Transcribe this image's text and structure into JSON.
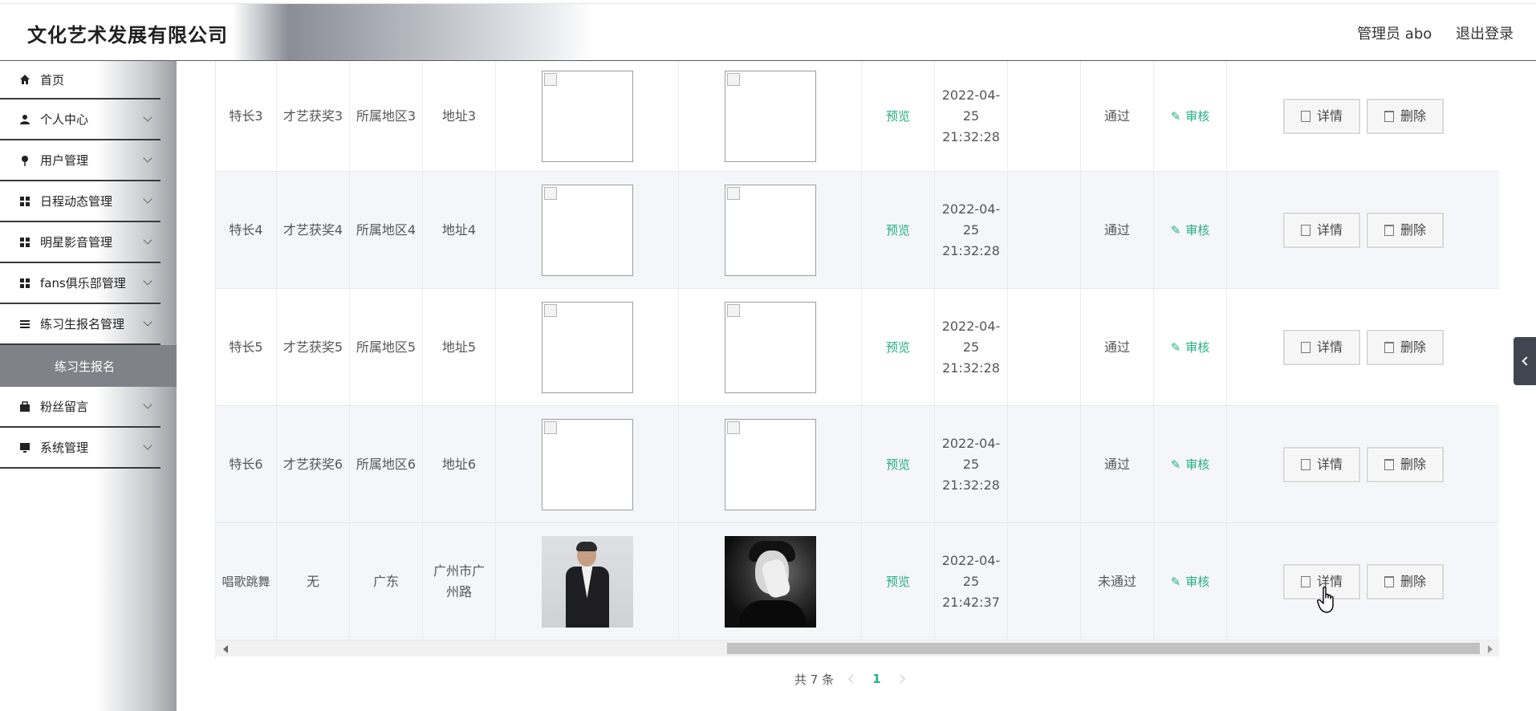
{
  "header": {
    "brand": "文化艺术发展有限公司",
    "user_label": "管理员 abo",
    "logout_label": "退出登录"
  },
  "sidebar": {
    "items": [
      {
        "label": "首页",
        "icon": "home-icon"
      },
      {
        "label": "个人中心",
        "icon": "user-icon"
      },
      {
        "label": "用户管理",
        "icon": "pin-icon"
      },
      {
        "label": "日程动态管理",
        "icon": "grid-icon"
      },
      {
        "label": "明星影音管理",
        "icon": "grid-icon"
      },
      {
        "label": "fans俱乐部管理",
        "icon": "grid-icon"
      },
      {
        "label": "练习生报名管理",
        "icon": "list-icon"
      },
      {
        "label": "粉丝留言",
        "icon": "briefcase-icon"
      },
      {
        "label": "系统管理",
        "icon": "monitor-icon"
      }
    ],
    "active_sub": "练习生报名"
  },
  "table": {
    "rows": [
      {
        "talent": "特长3",
        "award": "才艺获奖3",
        "region": "所属地区3",
        "address": "地址3",
        "preview": "预览",
        "time": "2022-04-25 21:32:28",
        "status": "通过",
        "audit": "审核",
        "detail": "详情",
        "delete": "删除"
      },
      {
        "talent": "特长4",
        "award": "才艺获奖4",
        "region": "所属地区4",
        "address": "地址4",
        "preview": "预览",
        "time": "2022-04-25 21:32:28",
        "status": "通过",
        "audit": "审核",
        "detail": "详情",
        "delete": "删除"
      },
      {
        "talent": "特长5",
        "award": "才艺获奖5",
        "region": "所属地区5",
        "address": "地址5",
        "preview": "预览",
        "time": "2022-04-25 21:32:28",
        "status": "通过",
        "audit": "审核",
        "detail": "详情",
        "delete": "删除"
      },
      {
        "talent": "特长6",
        "award": "才艺获奖6",
        "region": "所属地区6",
        "address": "地址6",
        "preview": "预览",
        "time": "2022-04-25 21:32:28",
        "status": "通过",
        "audit": "审核",
        "detail": "详情",
        "delete": "删除"
      },
      {
        "talent": "唱歌跳舞",
        "award": "无",
        "region": "广东",
        "address": "广州市广州路",
        "preview": "预览",
        "time": "2022-04-25 21:42:37",
        "status": "未通过",
        "audit": "审核",
        "detail": "详情",
        "delete": "删除"
      }
    ]
  },
  "pagination": {
    "total": "共 7 条",
    "current_page": "1"
  },
  "colors": {
    "accent_green": "#23b07d",
    "active_menu_bg": "#7f8288"
  }
}
